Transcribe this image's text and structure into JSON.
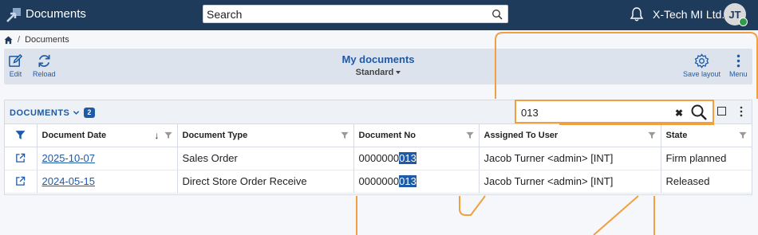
{
  "app": {
    "title": "Documents",
    "company": "X-Tech MI Ltd.",
    "avatar_initials": "JT",
    "search_placeholder": "Search"
  },
  "breadcrumb": {
    "current": "Documents"
  },
  "toolbar": {
    "edit_label": "Edit",
    "reload_label": "Reload",
    "title": "My documents",
    "view": "Standard",
    "save_layout_label": "Save layout",
    "menu_label": "Menu"
  },
  "panel": {
    "title": "DOCUMENTS",
    "count": "2",
    "filter_value": "013"
  },
  "columns": [
    "Document Date",
    "Document Type",
    "Document No",
    "Assigned To User",
    "State"
  ],
  "rows": [
    {
      "date": "2025-10-07",
      "type": "Sales Order",
      "no_prefix": "0000000",
      "no_match": "013",
      "user": "Jacob Turner <admin> [INT]",
      "state": "Firm planned"
    },
    {
      "date": "2024-05-15",
      "type": "Direct Store Order Receive",
      "no_prefix": "0000000",
      "no_match": "013",
      "user": "Jacob Turner <admin> [INT]",
      "state": "Released"
    }
  ],
  "colors": {
    "topbar": "#1f3b5c",
    "accent": "#1f5aa6",
    "highlight_outline": "#f0a040"
  }
}
